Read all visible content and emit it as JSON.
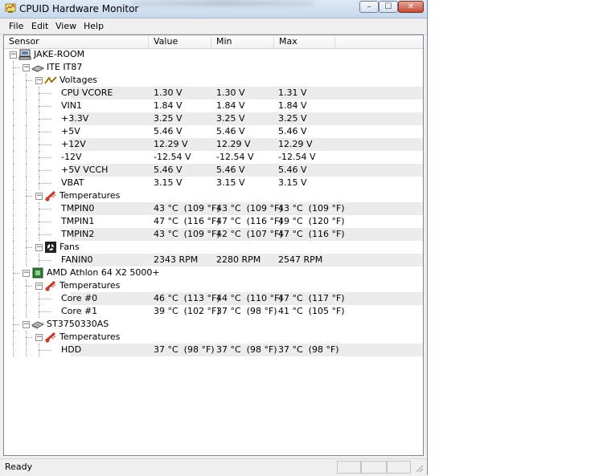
{
  "window": {
    "title": "CPUID Hardware Monitor",
    "controls": {
      "minimize": "–",
      "maximize": "☐",
      "close": "✕"
    }
  },
  "menu": [
    "File",
    "Edit",
    "View",
    "Help"
  ],
  "columns": {
    "sensor": "Sensor",
    "value": "Value",
    "min": "Min",
    "max": "Max"
  },
  "rows": [
    {
      "level": 0,
      "label": "JAKE-ROOM",
      "icon": "computer-icon",
      "expander": "−"
    },
    {
      "level": 1,
      "label": "ITE IT87",
      "icon": "chip-icon",
      "expander": "−"
    },
    {
      "level": 2,
      "label": "Voltages",
      "icon": "voltage-icon",
      "expander": "−"
    },
    {
      "level": 3,
      "label": "CPU VCORE",
      "value": "1.30 V",
      "min": "1.30 V",
      "max": "1.31 V"
    },
    {
      "level": 3,
      "label": "VIN1",
      "value": "1.84 V",
      "min": "1.84 V",
      "max": "1.84 V"
    },
    {
      "level": 3,
      "label": "+3.3V",
      "value": "3.25 V",
      "min": "3.25 V",
      "max": "3.25 V"
    },
    {
      "level": 3,
      "label": "+5V",
      "value": "5.46 V",
      "min": "5.46 V",
      "max": "5.46 V"
    },
    {
      "level": 3,
      "label": "+12V",
      "value": "12.29 V",
      "min": "12.29 V",
      "max": "12.29 V"
    },
    {
      "level": 3,
      "label": "-12V",
      "value": "-12.54 V",
      "min": "-12.54 V",
      "max": "-12.54 V"
    },
    {
      "level": 3,
      "label": "+5V VCCH",
      "value": "5.46 V",
      "min": "5.46 V",
      "max": "5.46 V"
    },
    {
      "level": 3,
      "label": "VBAT",
      "value": "3.15 V",
      "min": "3.15 V",
      "max": "3.15 V"
    },
    {
      "level": 2,
      "label": "Temperatures",
      "icon": "thermometer-icon",
      "expander": "−"
    },
    {
      "level": 3,
      "label": "TMPIN0",
      "value": "43 °C  (109 °F)",
      "min": "43 °C  (109 °F)",
      "max": "43 °C  (109 °F)"
    },
    {
      "level": 3,
      "label": "TMPIN1",
      "value": "47 °C  (116 °F)",
      "min": "47 °C  (116 °F)",
      "max": "49 °C  (120 °F)"
    },
    {
      "level": 3,
      "label": "TMPIN2",
      "value": "43 °C  (109 °F)",
      "min": "42 °C  (107 °F)",
      "max": "47 °C  (116 °F)"
    },
    {
      "level": 2,
      "label": "Fans",
      "icon": "fan-icon",
      "expander": "−"
    },
    {
      "level": 3,
      "label": "FANIN0",
      "value": "2343 RPM",
      "min": "2280 RPM",
      "max": "2547 RPM"
    },
    {
      "level": 1,
      "label": "AMD Athlon 64 X2 5000+",
      "icon": "cpu-icon",
      "expander": "−"
    },
    {
      "level": 2,
      "label": "Temperatures",
      "icon": "thermometer-icon",
      "expander": "−"
    },
    {
      "level": 3,
      "label": "Core #0",
      "value": "46 °C  (113 °F)",
      "min": "44 °C  (110 °F)",
      "max": "47 °C  (117 °F)"
    },
    {
      "level": 3,
      "label": "Core #1",
      "value": "39 °C  (102 °F)",
      "min": "37 °C  (98 °F)",
      "max": "41 °C  (105 °F)"
    },
    {
      "level": 1,
      "label": "ST3750330AS",
      "icon": "harddisk-icon",
      "expander": "−"
    },
    {
      "level": 2,
      "label": "Temperatures",
      "icon": "thermometer-icon",
      "expander": "−"
    },
    {
      "level": 3,
      "label": "HDD",
      "value": "37 °C  (98 °F)",
      "min": "37 °C  (98 °F)",
      "max": "37 °C  (98 °F)"
    }
  ],
  "status": {
    "text": "Ready"
  },
  "colors": {
    "row_shade": "#ececec",
    "tree_line": "#a0a0a0",
    "title_bar": "#dfe9f5"
  }
}
